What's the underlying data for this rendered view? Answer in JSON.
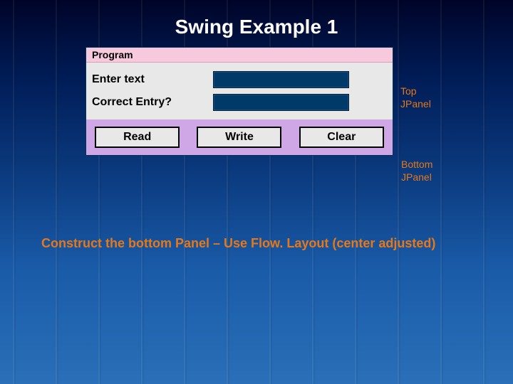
{
  "title": "Swing Example 1",
  "window": {
    "titlebar": "Program",
    "top_panel": {
      "label1": "Enter text",
      "field1_value": "",
      "label2": "Correct  Entry?",
      "field2_value": ""
    },
    "bottom_panel": {
      "btn_read": "Read",
      "btn_write": "Write",
      "btn_clear": "Clear"
    }
  },
  "annotations": {
    "top_line1": "Top",
    "top_line2": "JPanel",
    "bot_line1": "Bottom",
    "bot_line2": "JPanel"
  },
  "caption": "Construct the bottom Panel – Use Flow. Layout (center adjusted)"
}
